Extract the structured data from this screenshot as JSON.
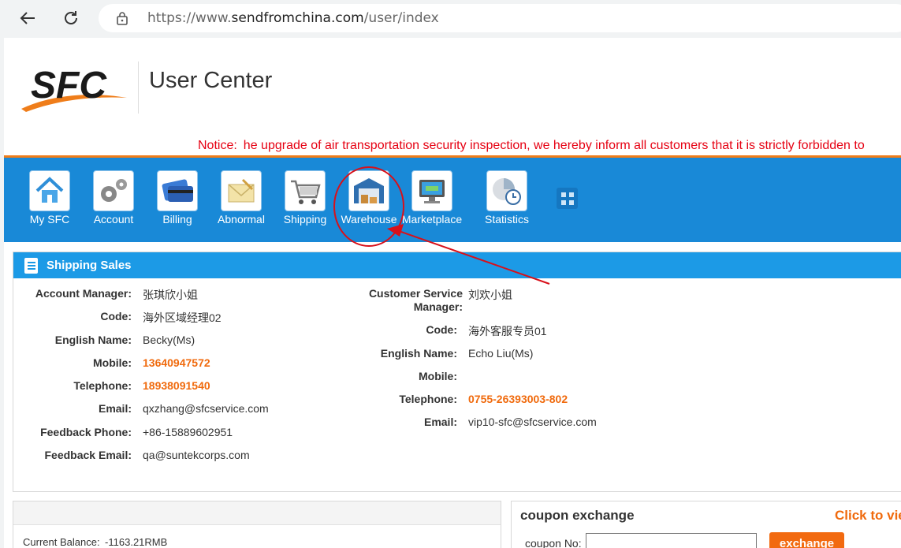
{
  "browser": {
    "url_prefix": "https://www.",
    "url_host": "sendfromchina.com",
    "url_path": "/user/index"
  },
  "header": {
    "logo_text": "SFC",
    "title": "User Center",
    "notice": "Notice: he upgrade of air transportation security inspection, we hereby inform all customers that it is strictly forbidden to"
  },
  "nav": {
    "items": [
      {
        "label": "My SFC",
        "icon": "home-icon"
      },
      {
        "label": "Account",
        "icon": "gears-icon"
      },
      {
        "label": "Billing",
        "icon": "credit-card-icon"
      },
      {
        "label": "Abnormal",
        "icon": "envelope-icon"
      },
      {
        "label": "Shipping",
        "icon": "shopping-cart-icon"
      },
      {
        "label": "Warehouse",
        "icon": "warehouse-icon"
      },
      {
        "label": "Marketplace",
        "icon": "monitor-icon"
      },
      {
        "label": "Statistics",
        "icon": "clock-chart-icon"
      }
    ],
    "more_icon": "grid-icon"
  },
  "shipping_sales": {
    "title": "Shipping Sales",
    "account_manager": {
      "rows": [
        {
          "label": "Account Manager:",
          "value": "张琪欣小姐",
          "highlight": false
        },
        {
          "label": "Code:",
          "value": "海外区域经理02",
          "highlight": false
        },
        {
          "label": "English Name:",
          "value": "Becky(Ms)",
          "highlight": false
        },
        {
          "label": "Mobile:",
          "value": "13640947572",
          "highlight": true
        },
        {
          "label": "Telephone:",
          "value": "18938091540",
          "highlight": true
        },
        {
          "label": "Email:",
          "value": "qxzhang@sfcservice.com",
          "highlight": false
        },
        {
          "label": "Feedback Phone:",
          "value": "+86-15889602951",
          "highlight": false
        },
        {
          "label": "Feedback Email:",
          "value": "qa@suntekcorps.com",
          "highlight": false
        }
      ]
    },
    "customer_service": {
      "label_line1": "Customer Service",
      "label_line2": "Manager:",
      "name": "刘欢小姐",
      "rows": [
        {
          "label": "Code:",
          "value": "海外客服专员01",
          "highlight": false
        },
        {
          "label": "English Name:",
          "value": "Echo Liu(Ms)",
          "highlight": false
        },
        {
          "label": "Mobile:",
          "value": "",
          "highlight": false
        },
        {
          "label": "Telephone:",
          "value": "0755-26393003-802",
          "highlight": true
        },
        {
          "label": "Email:",
          "value": "vip10-sfc@sfcservice.com",
          "highlight": false
        }
      ]
    }
  },
  "balance": {
    "text": "Current Balance: -1163.21RMB"
  },
  "coupon": {
    "title": "coupon exchange",
    "link": "Click to vie",
    "label": "coupon No:",
    "input_value": "",
    "button": "exchange"
  },
  "colors": {
    "nav_blue": "#1989d7",
    "accent_orange": "#f06a0d",
    "notice_red": "#e60012",
    "annotation_red": "#d8101a"
  }
}
